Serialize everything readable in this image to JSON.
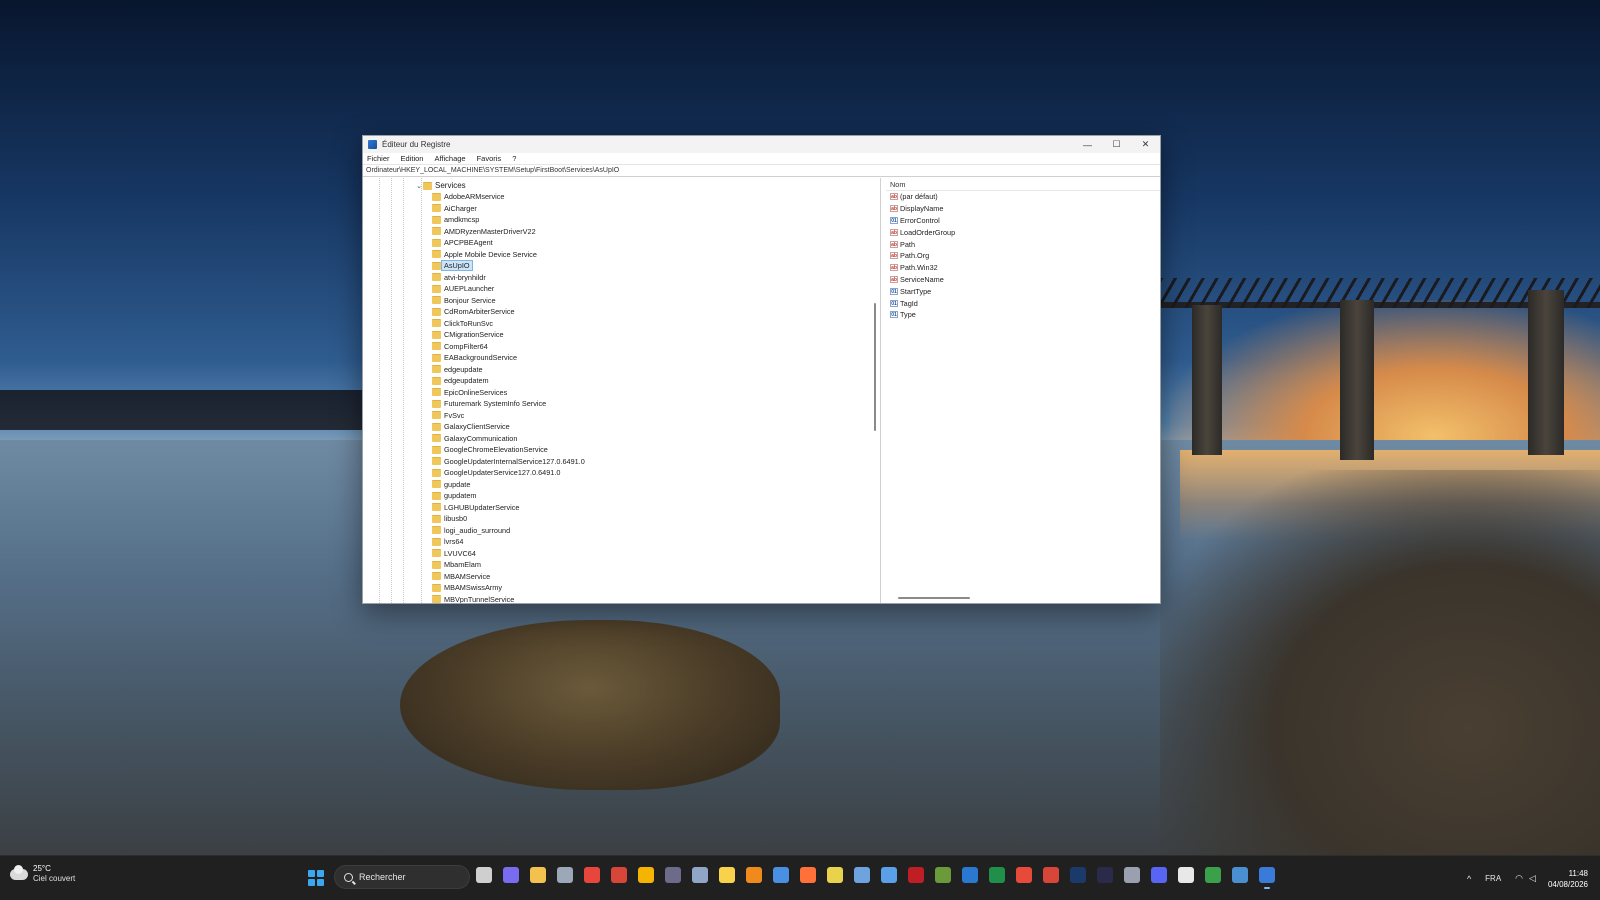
{
  "window": {
    "title": "Éditeur du Registre",
    "controls": {
      "minimize": "—",
      "maximize": "☐",
      "close": "✕"
    }
  },
  "menu": [
    "Fichier",
    "Edition",
    "Affichage",
    "Favoris",
    "?"
  ],
  "address": "Ordinateur\\HKEY_LOCAL_MACHINE\\SYSTEM\\Setup\\FirstBoot\\Services\\AsUpIO",
  "tree": {
    "parent": "Services",
    "items": [
      "AdobeARMservice",
      "AiCharger",
      "amdkmcsp",
      "AMDRyzenMasterDriverV22",
      "APCPBEAgent",
      "Apple Mobile Device Service",
      "AsUpIO",
      "atvi-brynhildr",
      "AUEPLauncher",
      "Bonjour Service",
      "CdRomArbiterService",
      "ClickToRunSvc",
      "CMigrationService",
      "CompFilter64",
      "EABackgroundService",
      "edgeupdate",
      "edgeupdatem",
      "EpicOnlineServices",
      "Futuremark SystemInfo Service",
      "FvSvc",
      "GalaxyClientService",
      "GalaxyCommunication",
      "GoogleChromeElevationService",
      "GoogleUpdaterInternalService127.0.6491.0",
      "GoogleUpdaterService127.0.6491.0",
      "gupdate",
      "gupdatem",
      "LGHUBUpdaterService",
      "libusb0",
      "logi_audio_surround",
      "lvrs64",
      "LVUVC64",
      "MbamElam",
      "MBAMService",
      "MBAMSwissArmy",
      "MBVpnTunnelService"
    ],
    "selected": "AsUpIO"
  },
  "values_pane": {
    "header": "Nom",
    "rows": [
      {
        "name": "(par défaut)",
        "type": "sz"
      },
      {
        "name": "DisplayName",
        "type": "sz"
      },
      {
        "name": "ErrorControl",
        "type": "dw"
      },
      {
        "name": "LoadOrderGroup",
        "type": "sz"
      },
      {
        "name": "Path",
        "type": "sz"
      },
      {
        "name": "Path.Org",
        "type": "sz"
      },
      {
        "name": "Path.Win32",
        "type": "sz"
      },
      {
        "name": "ServiceName",
        "type": "sz"
      },
      {
        "name": "StartType",
        "type": "dw"
      },
      {
        "name": "TagId",
        "type": "dw"
      },
      {
        "name": "Type",
        "type": "dw"
      }
    ]
  },
  "taskbar": {
    "weather": {
      "temp": "25°C",
      "description": "Ciel couvert"
    },
    "search_placeholder": "Rechercher",
    "apps": [
      {
        "name": "task-view-icon",
        "color": "#cfcfcf"
      },
      {
        "name": "copilot-icon",
        "color": "#7a6cf0"
      },
      {
        "name": "file-explorer-icon",
        "color": "#f2c14e"
      },
      {
        "name": "calculator-icon",
        "color": "#9aa8b8"
      },
      {
        "name": "chrome-icon",
        "color": "#e8453c"
      },
      {
        "name": "gmail-icon",
        "color": "#d8463a"
      },
      {
        "name": "chrome-canary-icon",
        "color": "#f5b400"
      },
      {
        "name": "app-icon",
        "color": "#6c6c8a"
      },
      {
        "name": "app-icon",
        "color": "#8fa6c8"
      },
      {
        "name": "bulb-icon",
        "color": "#f7d24a"
      },
      {
        "name": "vlc-icon",
        "color": "#f08a1c"
      },
      {
        "name": "app-icon",
        "color": "#4a90e2"
      },
      {
        "name": "firefox-icon",
        "color": "#ff7139"
      },
      {
        "name": "flask-icon",
        "color": "#e8d34a"
      },
      {
        "name": "app-icon",
        "color": "#6fa3e0"
      },
      {
        "name": "notepad-icon",
        "color": "#5aa0e8"
      },
      {
        "name": "filezilla-icon",
        "color": "#bf1e24"
      },
      {
        "name": "app-icon",
        "color": "#6a9a3a"
      },
      {
        "name": "outlook-icon",
        "color": "#2a78d0"
      },
      {
        "name": "excel-icon",
        "color": "#1f8f4a"
      },
      {
        "name": "app-icon",
        "color": "#e84a3a"
      },
      {
        "name": "gmail-icon",
        "color": "#d8463a"
      },
      {
        "name": "photoshop-icon",
        "color": "#1a3a6a"
      },
      {
        "name": "app-icon",
        "color": "#2a2a4a"
      },
      {
        "name": "app-icon",
        "color": "#9aa0b0"
      },
      {
        "name": "discord-icon",
        "color": "#5865f2"
      },
      {
        "name": "app-icon",
        "color": "#e8e8e8"
      },
      {
        "name": "app-icon",
        "color": "#3aa04a"
      },
      {
        "name": "app-icon",
        "color": "#4a90d0"
      },
      {
        "name": "regedit-icon",
        "color": "#3a7ad8"
      }
    ],
    "tray": {
      "chevron": "^",
      "language": "FRA",
      "wifi": "◠",
      "volume": "◁"
    },
    "clock": {
      "time": "11:48",
      "date": "04/08/2026"
    }
  }
}
